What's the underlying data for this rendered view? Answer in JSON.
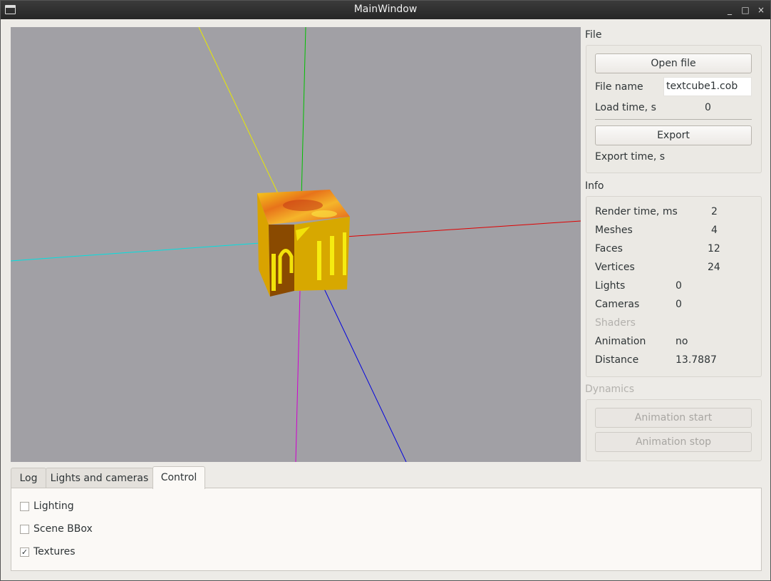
{
  "window": {
    "title": "MainWindow",
    "controls": [
      "_",
      "□",
      "×"
    ]
  },
  "file": {
    "group_title": "File",
    "open_button": "Open file",
    "file_name_label": "File name",
    "file_name_value": "textcube1.cob",
    "load_time_label": "Load time, s",
    "load_time_value": "0",
    "export_button": "Export",
    "export_time_label": "Export time, s"
  },
  "info": {
    "group_title": "Info",
    "rows": [
      {
        "label": "Render time, ms",
        "value": "2"
      },
      {
        "label": "Meshes",
        "value": "4"
      },
      {
        "label": "Faces",
        "value": "12"
      },
      {
        "label": "Vertices",
        "value": "24"
      },
      {
        "label": "Lights",
        "value": "0"
      },
      {
        "label": "Cameras",
        "value": "0"
      },
      {
        "label": "Shaders",
        "value": ""
      },
      {
        "label": "Animation",
        "value": "no"
      },
      {
        "label": "Distance",
        "value": "13.7887"
      }
    ]
  },
  "dynamics": {
    "group_title": "Dynamics",
    "start_button": "Animation start",
    "stop_button": "Animation stop"
  },
  "tabs": [
    {
      "label": "Log",
      "active": false
    },
    {
      "label": "Lights and cameras",
      "active": false
    },
    {
      "label": "Control",
      "active": true
    }
  ],
  "control": {
    "lighting": {
      "label": "Lighting",
      "checked": false
    },
    "scene_bbox": {
      "label": "Scene BBox",
      "checked": false
    },
    "textures": {
      "label": "Textures",
      "checked": true,
      "mark": "✓"
    }
  },
  "colors": {
    "viewport_bg": "#a1a0a5",
    "axis_x": "#e00000",
    "axis_y": "#00c000",
    "axis_z": "#0000e0",
    "axis_neg_x": "#00e0e0",
    "axis_neg_y": "#d000d0",
    "axis_neg_z": "#e8e800"
  }
}
